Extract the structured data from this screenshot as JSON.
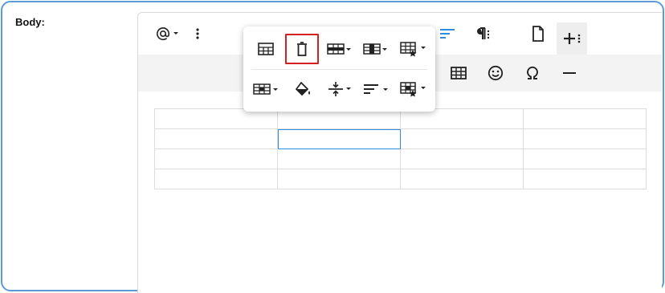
{
  "field": {
    "label": "Body:"
  },
  "toolbar": {
    "row1": [
      {
        "name": "mention-dropdown-button",
        "icon": "at-sign-icon"
      },
      {
        "name": "more-options-button",
        "icon": "vertical-dots-icon"
      },
      {
        "name": "align-button",
        "icon": "align-left-icon",
        "color": "#2f8ee0"
      },
      {
        "name": "paragraph-format-button",
        "icon": "paragraph-icon"
      },
      {
        "name": "document-button",
        "icon": "page-icon"
      },
      {
        "name": "insert-more-button",
        "icon": "plus-more-icon"
      }
    ],
    "row2": [
      {
        "name": "insert-table-button",
        "icon": "table-icon"
      },
      {
        "name": "emoji-button",
        "icon": "smiley-icon"
      },
      {
        "name": "special-characters-button",
        "icon": "omega-icon"
      },
      {
        "name": "horizontal-line-button",
        "icon": "minus-icon"
      }
    ]
  },
  "table_popup": {
    "row1": [
      {
        "name": "table-header-button",
        "icon": "table-header-icon"
      },
      {
        "name": "remove-table-button",
        "icon": "trash-icon",
        "highlighted": true
      },
      {
        "name": "table-rows-button",
        "icon": "table-rows-icon"
      },
      {
        "name": "table-columns-button",
        "icon": "table-columns-icon"
      },
      {
        "name": "table-style-button",
        "icon": "table-style-icon"
      }
    ],
    "row2": [
      {
        "name": "table-cells-button",
        "icon": "table-cells-icon"
      },
      {
        "name": "cell-background-button",
        "icon": "paint-bucket-icon"
      },
      {
        "name": "vertical-align-button",
        "icon": "vertical-align-icon"
      },
      {
        "name": "horizontal-align-button",
        "icon": "horizontal-align-icon"
      },
      {
        "name": "cell-style-button",
        "icon": "cell-style-icon"
      }
    ]
  },
  "table": {
    "rows": 4,
    "cols": 4,
    "active_cell": [
      1,
      1
    ]
  },
  "colors": {
    "accent": "#2f8ee0",
    "frame": "#5b9bd5",
    "highlight": "#d62020"
  }
}
